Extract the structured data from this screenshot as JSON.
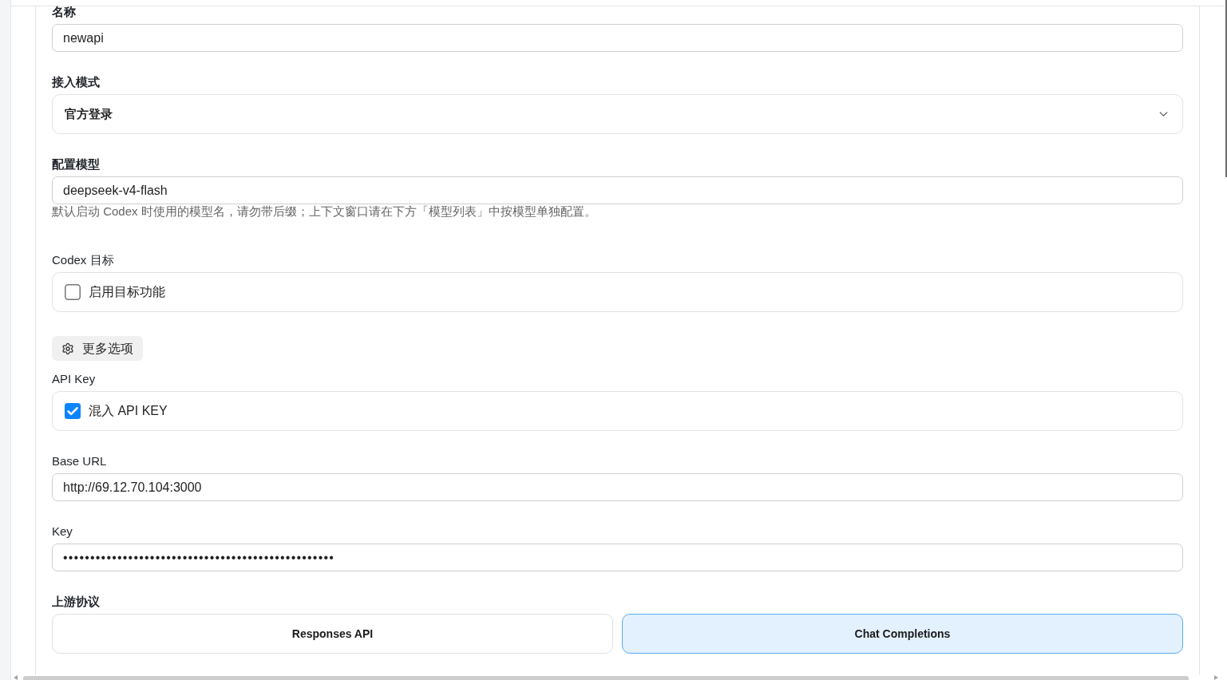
{
  "fields": [
    {
      "kind": "text",
      "label": "名称",
      "label_bold": true,
      "value": "newapi"
    },
    {
      "kind": "select",
      "label": "接入模式",
      "label_bold": true,
      "value": "官方登录"
    },
    {
      "kind": "text",
      "label": "配置模型",
      "label_bold": true,
      "value": "deepseek-v4-flash",
      "hint": "默认启动 Codex 时使用的模型名，请勿带后缀；上下文窗口请在下方「模型列表」中按模型单独配置。"
    },
    {
      "kind": "checkbox",
      "label": "Codex 目标",
      "label_bold": false,
      "option": "启用目标功能",
      "checked": false
    },
    {
      "kind": "button",
      "label": "更多选项"
    },
    {
      "kind": "checkbox",
      "label": "API Key",
      "label_bold": false,
      "option": "混入 API KEY",
      "checked": true
    },
    {
      "kind": "text",
      "label": "Base URL",
      "label_bold": false,
      "value": "http://69.12.70.104:3000"
    },
    {
      "kind": "password",
      "label": "Key",
      "label_bold": false,
      "value": "••••••••••••••••••••••••••••••••••••••••••••••••••"
    },
    {
      "kind": "segmented",
      "label": "上游协议",
      "label_bold": true,
      "options": [
        {
          "label": "Responses API",
          "selected": false
        },
        {
          "label": "Chat Completions",
          "selected": true
        }
      ]
    }
  ]
}
